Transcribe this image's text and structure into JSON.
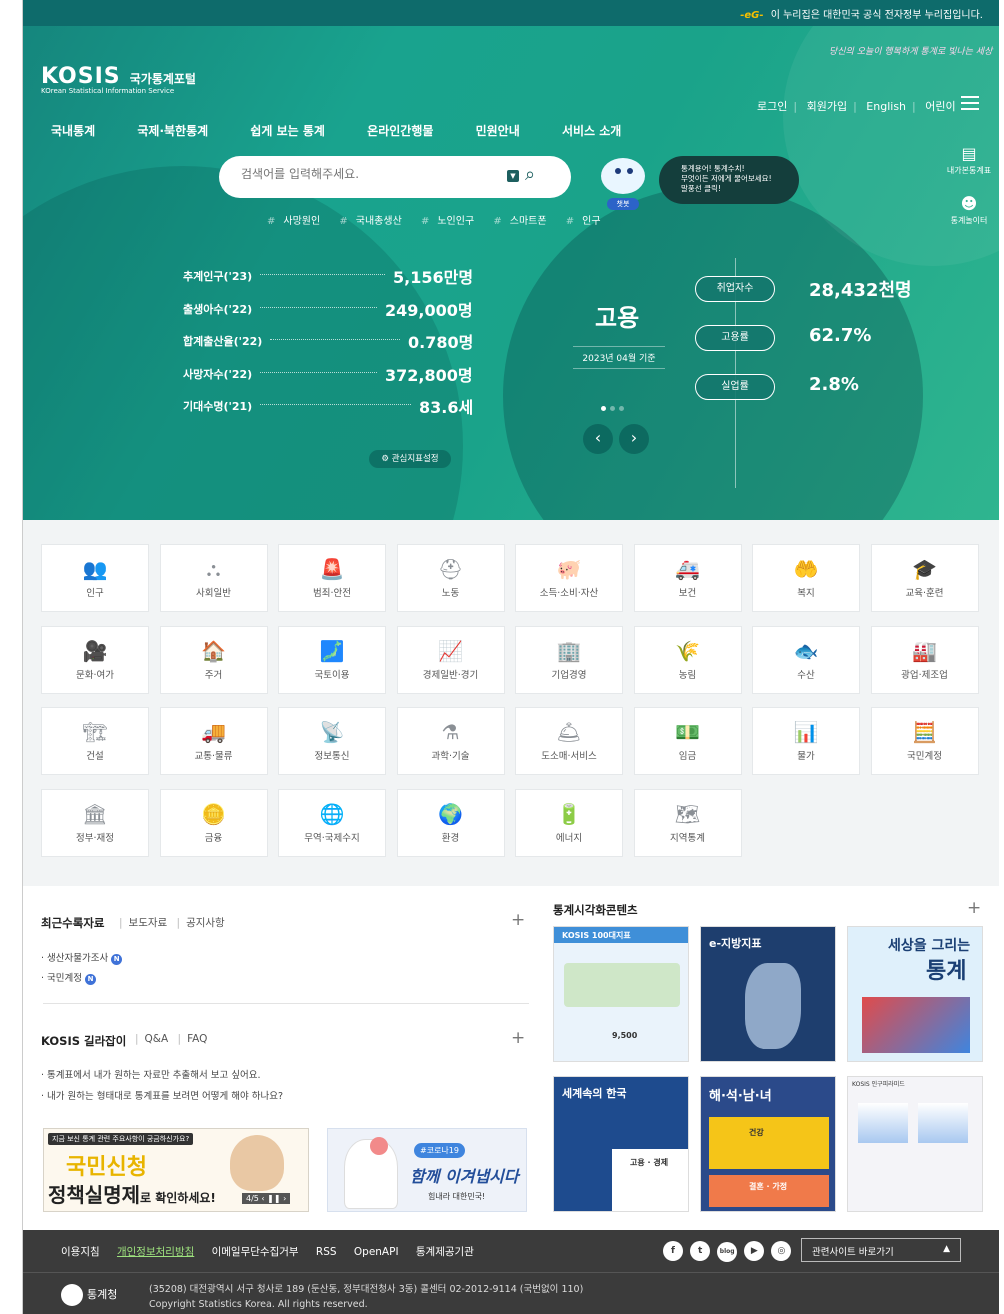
{
  "topbar": {
    "eg_mark": "-eG-",
    "notice": "이 누리집은 대한민국 공식 전자정부 누리집입니다."
  },
  "header": {
    "logo_big": "KOSIS",
    "logo_kr": "국가통계포털",
    "logo_sub": "KOrean Statistical Information Service",
    "slogan": "당신의 오늘이 행복하게 통계로 빛나는 세상",
    "util": {
      "login": "로그인",
      "join": "회원가입",
      "english": "English",
      "kids": "어린이"
    },
    "gnb": [
      "국내통계",
      "국제·북한통계",
      "쉽게 보는 통계",
      "온라인간행물",
      "민원안내",
      "서비스 소개"
    ],
    "side": {
      "my_stats": "내가본통계표",
      "playground": "통계놀이터"
    }
  },
  "search": {
    "placeholder": "검색어를 입력해주세요.",
    "tags": [
      "사망원인",
      "국내총생산",
      "노인인구",
      "스마트폰",
      "인구"
    ]
  },
  "chatbot": {
    "name": "챗봇",
    "line1": "통계용어! 통계수치!",
    "line2": "무엇이든 저에게 물어보세요!",
    "line3": "말풍선 클릭!"
  },
  "key_stats": [
    {
      "label": "추계인구('23)",
      "value": "5,156만명"
    },
    {
      "label": "출생아수('22)",
      "value": "249,000명"
    },
    {
      "label": "합계출산율('22)",
      "value": "0.780명"
    },
    {
      "label": "사망자수('22)",
      "value": "372,800명"
    },
    {
      "label": "기대수명('21)",
      "value": "83.6세"
    }
  ],
  "interest_button": "관심지표설정",
  "employment": {
    "title": "고용",
    "date": "2023년 04월 기준",
    "items": [
      {
        "label": "취업자수",
        "value": "28,432천명"
      },
      {
        "label": "고용률",
        "value": "62.7%"
      },
      {
        "label": "실업률",
        "value": "2.8%"
      }
    ]
  },
  "categories": [
    {
      "label": "인구",
      "icon": "people-icon",
      "glyph": "👥"
    },
    {
      "label": "사회일반",
      "icon": "network-icon",
      "glyph": "⛬"
    },
    {
      "label": "범죄·안전",
      "icon": "siren-icon",
      "glyph": "🚨"
    },
    {
      "label": "노동",
      "icon": "helmet-icon",
      "glyph": "⛑"
    },
    {
      "label": "소득·소비·자산",
      "icon": "piggy-bank-icon",
      "glyph": "🐖"
    },
    {
      "label": "보건",
      "icon": "ambulance-icon",
      "glyph": "🚑"
    },
    {
      "label": "복지",
      "icon": "care-hand-icon",
      "glyph": "🤲"
    },
    {
      "label": "교육·훈련",
      "icon": "graduation-icon",
      "glyph": "🎓"
    },
    {
      "label": "문화·여가",
      "icon": "camera-icon",
      "glyph": "🎥"
    },
    {
      "label": "주거",
      "icon": "house-icon",
      "glyph": "🏠"
    },
    {
      "label": "국토이용",
      "icon": "land-map-icon",
      "glyph": "🗾"
    },
    {
      "label": "경제일반·경기",
      "icon": "chart-up-icon",
      "glyph": "📈"
    },
    {
      "label": "기업경영",
      "icon": "office-icon",
      "glyph": "🏢"
    },
    {
      "label": "농림",
      "icon": "plant-icon",
      "glyph": "🌾"
    },
    {
      "label": "수산",
      "icon": "fish-icon",
      "glyph": "🐟"
    },
    {
      "label": "광업·제조업",
      "icon": "factory-icon",
      "glyph": "🏭"
    },
    {
      "label": "건설",
      "icon": "crane-icon",
      "glyph": "🏗"
    },
    {
      "label": "교통·물류",
      "icon": "truck-icon",
      "glyph": "🚚"
    },
    {
      "label": "정보통신",
      "icon": "satellite-icon",
      "glyph": "📡"
    },
    {
      "label": "과학·기술",
      "icon": "flask-icon",
      "glyph": "⚗"
    },
    {
      "label": "도소매·서비스",
      "icon": "service-icon",
      "glyph": "🛎"
    },
    {
      "label": "임금",
      "icon": "money-icon",
      "glyph": "💵"
    },
    {
      "label": "물가",
      "icon": "price-chart-icon",
      "glyph": "📊"
    },
    {
      "label": "국민계정",
      "icon": "calculator-icon",
      "glyph": "🧮"
    },
    {
      "label": "정부·재정",
      "icon": "government-icon",
      "glyph": "🏛"
    },
    {
      "label": "금융",
      "icon": "coins-icon",
      "glyph": "🪙"
    },
    {
      "label": "무역·국제수지",
      "icon": "globe-icon",
      "glyph": "🌐"
    },
    {
      "label": "환경",
      "icon": "earth-icon",
      "glyph": "🌍"
    },
    {
      "label": "에너지",
      "icon": "battery-icon",
      "glyph": "🔋"
    },
    {
      "label": "지역통계",
      "icon": "region-map-icon",
      "glyph": "🗺"
    }
  ],
  "recent": {
    "title": "최근수록자료",
    "tabs": [
      "보도자료",
      "공지사항"
    ],
    "items": [
      "생산자물가조사",
      "국민계정"
    ]
  },
  "guide": {
    "title": "KOSIS 길라잡이",
    "tabs": [
      "Q&A",
      "FAQ"
    ],
    "items": [
      "통계표에서 내가 원하는 자료만 추출해서 보고 싶어요.",
      "내가 원하는 형태대로 통계표를 보려면 어떻게 해야 하나요?"
    ]
  },
  "banner1": {
    "top": "지금 보신 통계 관련 주요사항이 궁금하신가요?",
    "line1": "국민신청",
    "line2": "정책실명제",
    "line2_suffix": "로 확인하세요!",
    "pager": "4/5"
  },
  "banner2": {
    "hashtag": "#코로나19",
    "text": "함께 이겨냅시다",
    "sub": "힘내라 대한민국!"
  },
  "viz": {
    "title": "통계시각화콘텐츠",
    "cards": [
      {
        "title": "KOSIS 100대지표",
        "color": "#3f8fd8"
      },
      {
        "title": "e-지방지표",
        "color": "#1e3e6e"
      },
      {
        "title": "세상을 그리는 통계",
        "color": "#2aa0d8"
      },
      {
        "title": "세계속의 한국",
        "color": "#1e4b8e"
      },
      {
        "title": "해·석·남·녀",
        "color": "#2b4a8a"
      },
      {
        "title": "KOSIS 인구피라미드",
        "color": "#f4f4f8"
      }
    ],
    "card_text": {
      "c3_line1": "세상을 그리는",
      "c3_line2": "통계",
      "c4_sub": "고용 · 경제",
      "c5_sub1": "건강",
      "c5_sub2": "결혼 · 가정",
      "c1_value": "9,500"
    }
  },
  "footer": {
    "links": [
      "이용지침",
      "개인정보처리방침",
      "이메일무단수집거부",
      "RSS",
      "OpenAPI",
      "통계제공기관"
    ],
    "related": "관련사이트 바로가기",
    "org": "통계청",
    "address": "(35208) 대전광역시 서구 청사로 189 (둔산동, 정부대전청사 3동) 콜센터 02-2012-9114 (국번없이 110)",
    "copyright": "Copyright Statistics Korea. All rights reserved."
  },
  "colors": {
    "brand": "#0e6b6b",
    "hero_start": "#15867d",
    "hero_end": "#2fb58f",
    "footer": "#3b3b3b",
    "link_highlight": "#9ee27e"
  }
}
